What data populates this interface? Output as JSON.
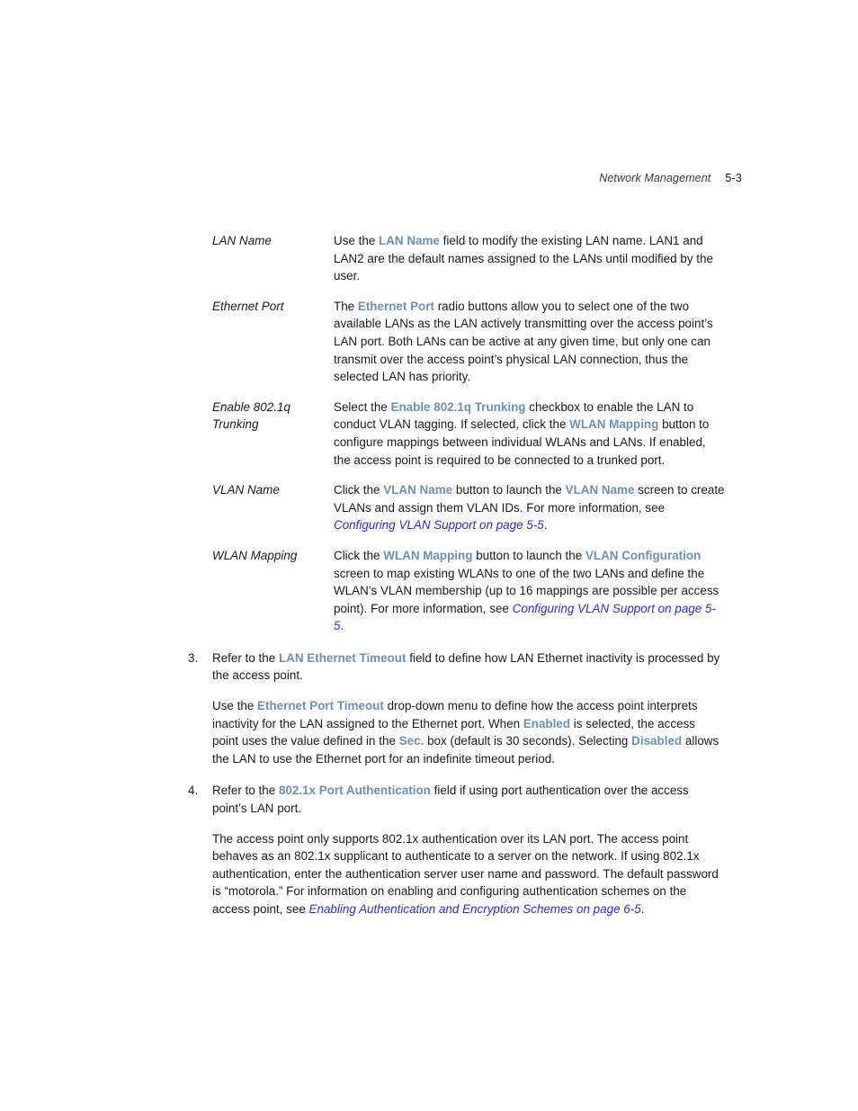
{
  "header": {
    "chapter_title": "Network Management",
    "folio": "5-3"
  },
  "definitions": [
    {
      "term": "LAN Name",
      "segments": [
        {
          "text": "Use the ",
          "style": "plain"
        },
        {
          "text": "LAN Name",
          "style": "ui-term"
        },
        {
          "text": " field to modify the existing LAN name. LAN1 and LAN2 are the default names assigned to the LANs until modified by the user.",
          "style": "plain"
        }
      ]
    },
    {
      "term": "Ethernet Port",
      "segments": [
        {
          "text": "The ",
          "style": "plain"
        },
        {
          "text": "Ethernet Port",
          "style": "ui-term"
        },
        {
          "text": " radio buttons allow you to select one of the two available LANs as the LAN actively transmitting over the access point’s LAN port. Both LANs can be active at any given time, but only one can transmit over the access point’s physical LAN connection, thus the selected LAN has priority.",
          "style": "plain"
        }
      ]
    },
    {
      "term": "Enable 802.1q Trunking",
      "segments": [
        {
          "text": "Select the ",
          "style": "plain"
        },
        {
          "text": "Enable 802.1q Trunking",
          "style": "ui-term"
        },
        {
          "text": " checkbox to enable the LAN to conduct VLAN tagging. If selected, click the ",
          "style": "plain"
        },
        {
          "text": "WLAN Mapping",
          "style": "ui-term"
        },
        {
          "text": " button to configure mappings between individual WLANs and LANs. If enabled, the access point is required to be connected to a trunked port.",
          "style": "plain"
        }
      ]
    },
    {
      "term": "VLAN Name",
      "segments": [
        {
          "text": "Click the ",
          "style": "plain"
        },
        {
          "text": "VLAN Name",
          "style": "ui-term"
        },
        {
          "text": " button to launch the ",
          "style": "plain"
        },
        {
          "text": "VLAN Name",
          "style": "ui-term"
        },
        {
          "text": " screen to create VLANs and assign them VLAN IDs. For more information, see ",
          "style": "plain"
        },
        {
          "text": "Configuring VLAN Support on page 5-5",
          "style": "xref"
        },
        {
          "text": ".",
          "style": "plain"
        }
      ]
    },
    {
      "term": "WLAN Mapping",
      "segments": [
        {
          "text": "Click the ",
          "style": "plain"
        },
        {
          "text": "WLAN Mapping",
          "style": "ui-term"
        },
        {
          "text": " button to launch the ",
          "style": "plain"
        },
        {
          "text": "VLAN Configuration",
          "style": "ui-term"
        },
        {
          "text": " screen to map existing WLANs to one of the two LANs and define the WLAN’s VLAN membership (up to 16 mappings are possible per access point). For more information, see ",
          "style": "plain"
        },
        {
          "text": "Configuring VLAN Support on page 5-5",
          "style": "xref"
        },
        {
          "text": ".",
          "style": "plain"
        }
      ]
    }
  ],
  "steps": [
    {
      "number": "3.",
      "paragraphs": [
        [
          {
            "text": "Refer to the ",
            "style": "plain"
          },
          {
            "text": "LAN Ethernet Timeout",
            "style": "ui-term"
          },
          {
            "text": " field to define how LAN Ethernet inactivity is processed by the access point.",
            "style": "plain"
          }
        ],
        [
          {
            "text": "Use the ",
            "style": "plain"
          },
          {
            "text": "Ethernet Port Timeout",
            "style": "ui-term"
          },
          {
            "text": " drop-down menu to define how the access point interprets inactivity for the LAN assigned to the Ethernet port. When ",
            "style": "plain"
          },
          {
            "text": "Enabled",
            "style": "ui-term"
          },
          {
            "text": " is selected, the access point uses the value defined in the ",
            "style": "plain"
          },
          {
            "text": "Sec.",
            "style": "ui-term"
          },
          {
            "text": " box (default is 30 seconds). Selecting ",
            "style": "plain"
          },
          {
            "text": "Disabled",
            "style": "ui-term"
          },
          {
            "text": " allows the LAN to use the Ethernet port for an indefinite timeout period.",
            "style": "plain"
          }
        ]
      ]
    },
    {
      "number": "4.",
      "paragraphs": [
        [
          {
            "text": "Refer to the ",
            "style": "plain"
          },
          {
            "text": "802.1x Port Authentication",
            "style": "ui-term"
          },
          {
            "text": " field if using port authentication over the access point’s LAN port.",
            "style": "plain"
          }
        ],
        [
          {
            "text": "The access point only supports 802.1x authentication over its LAN port. The access point behaves as an 802.1x supplicant to authenticate to a server on the network. If using 802.1x authentication, enter the authentication server user name and password. The default password is “motorola.” For information on enabling and configuring authentication schemes on the access point, see ",
            "style": "plain"
          },
          {
            "text": "Enabling Authentication and Encryption Schemes on page 6-5",
            "style": "xref"
          },
          {
            "text": ".",
            "style": "plain"
          }
        ]
      ]
    }
  ],
  "colors": {
    "ui_term_blue": "#6d8fb3",
    "cross_reference_blue": "#2b2bdc",
    "body_text": "#1a1a1a",
    "page_background": "#ffffff"
  }
}
